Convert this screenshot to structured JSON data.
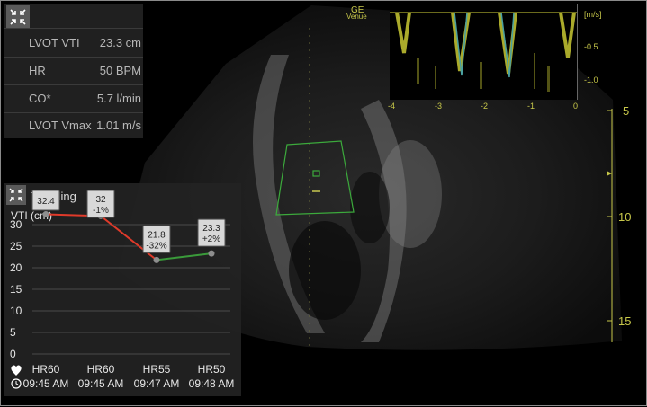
{
  "vendor": {
    "logo_line1": "GE",
    "logo_line2": "Venue"
  },
  "measurements": {
    "rows": [
      {
        "label": "LVOT VTI",
        "value": "23.3 cm"
      },
      {
        "label": "HR",
        "value": "50 BPM"
      },
      {
        "label": "CO*",
        "value": "5.7 l/min"
      },
      {
        "label": "LVOT Vmax",
        "value": "1.01 m/s"
      }
    ]
  },
  "doppler": {
    "unit": "[m/s]",
    "y_ticks": [
      "-0.5",
      "-1.0"
    ],
    "x_ticks": [
      "-4",
      "-3",
      "-2",
      "-1",
      "0"
    ]
  },
  "depth_scale": {
    "marks": [
      "5",
      "10",
      "15"
    ]
  },
  "trend": {
    "title": "Trending",
    "ylabel": "VTI (cm)",
    "footer_icons": [
      "heart-icon",
      "clock-icon"
    ],
    "colors": {
      "decrease": "#e03a2a",
      "increase": "#3a9a3a",
      "point": "#8e8e8e"
    },
    "chart_data": {
      "type": "line",
      "ylabel": "VTI (cm)",
      "ylim": [
        0,
        30
      ],
      "y_ticks": [
        0,
        5,
        10,
        15,
        20,
        25,
        30
      ],
      "grid": true,
      "categories": [
        {
          "hr": "HR60",
          "time": "09:45 AM"
        },
        {
          "hr": "HR60",
          "time": "09:45 AM"
        },
        {
          "hr": "HR55",
          "time": "09:47 AM"
        },
        {
          "hr": "HR50",
          "time": "09:48 AM"
        }
      ],
      "values": [
        32.4,
        32,
        21.8,
        23.3
      ],
      "labels": [
        {
          "value": "32.4",
          "change": ""
        },
        {
          "value": "32",
          "change": "-1%"
        },
        {
          "value": "21.8",
          "change": "-32%"
        },
        {
          "value": "23.3",
          "change": "+2%"
        }
      ]
    }
  }
}
